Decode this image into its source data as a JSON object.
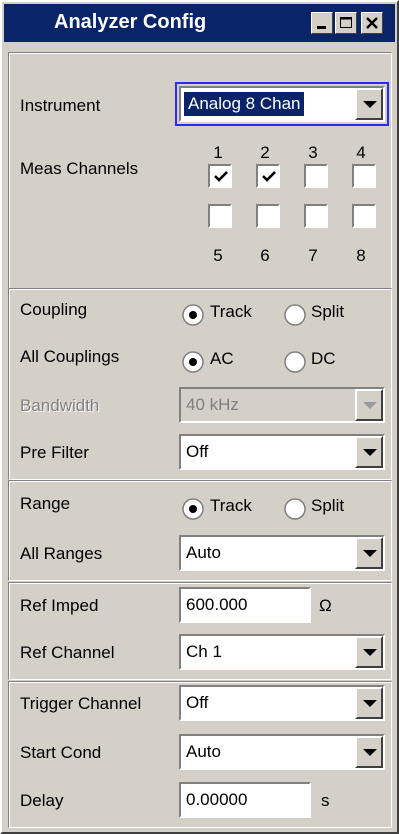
{
  "window": {
    "title": "Analyzer Config",
    "controls": [
      "minimize-icon",
      "maximize-icon",
      "close-icon"
    ]
  },
  "instrument": {
    "label": "Instrument",
    "value": "Analog   8 Chan"
  },
  "meas_channels": {
    "label": "Meas Channels",
    "channels": [
      {
        "number": "1",
        "checked": true
      },
      {
        "number": "2",
        "checked": true
      },
      {
        "number": "3",
        "checked": false
      },
      {
        "number": "4",
        "checked": false
      },
      {
        "number": "5",
        "checked": false
      },
      {
        "number": "6",
        "checked": false
      },
      {
        "number": "7",
        "checked": false
      },
      {
        "number": "8",
        "checked": false
      }
    ]
  },
  "coupling": {
    "label": "Coupling",
    "options": [
      "Track",
      "Split"
    ],
    "selected": "Track"
  },
  "all_couplings": {
    "label": "All Couplings",
    "options": [
      "AC",
      "DC"
    ],
    "selected": "AC"
  },
  "bandwidth": {
    "label": "Bandwidth",
    "value": "40 kHz",
    "enabled": false
  },
  "pre_filter": {
    "label": "Pre Filter",
    "value": "Off"
  },
  "range": {
    "label": "Range",
    "options": [
      "Track",
      "Split"
    ],
    "selected": "Track"
  },
  "all_ranges": {
    "label": "All Ranges",
    "value": "Auto"
  },
  "ref_imped": {
    "label": "Ref Imped",
    "value": "600.000",
    "unit": "Ω"
  },
  "ref_channel": {
    "label": "Ref Channel",
    "value": "Ch 1"
  },
  "trigger_channel": {
    "label": "Trigger Channel",
    "value": "Off"
  },
  "start_cond": {
    "label": "Start Cond",
    "value": "Auto"
  },
  "delay": {
    "label": "Delay",
    "value": "0.00000",
    "unit": "s"
  },
  "colors": {
    "title_bar": "#0a246a",
    "face": "#d4d0c8",
    "focus": "#2a2aff"
  }
}
